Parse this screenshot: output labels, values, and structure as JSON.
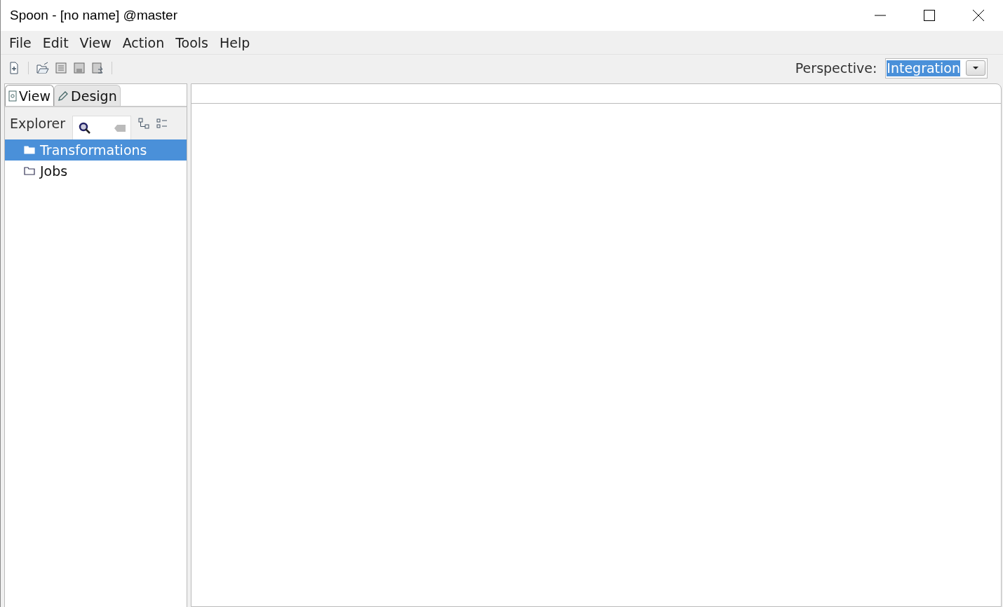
{
  "window": {
    "title": "Spoon - [no name] @master"
  },
  "menu": [
    "File",
    "Edit",
    "View",
    "Action",
    "Tools",
    "Help"
  ],
  "perspective": {
    "label": "Perspective:",
    "value": "Integration"
  },
  "tabs": [
    {
      "label": "View",
      "kind": "view",
      "selected": true
    },
    {
      "label": "Design",
      "kind": "design",
      "selected": false
    }
  ],
  "explorer": {
    "title": "Explorer"
  },
  "tree": [
    {
      "label": "Transformations",
      "selected": true
    },
    {
      "label": "Jobs",
      "selected": false
    }
  ]
}
